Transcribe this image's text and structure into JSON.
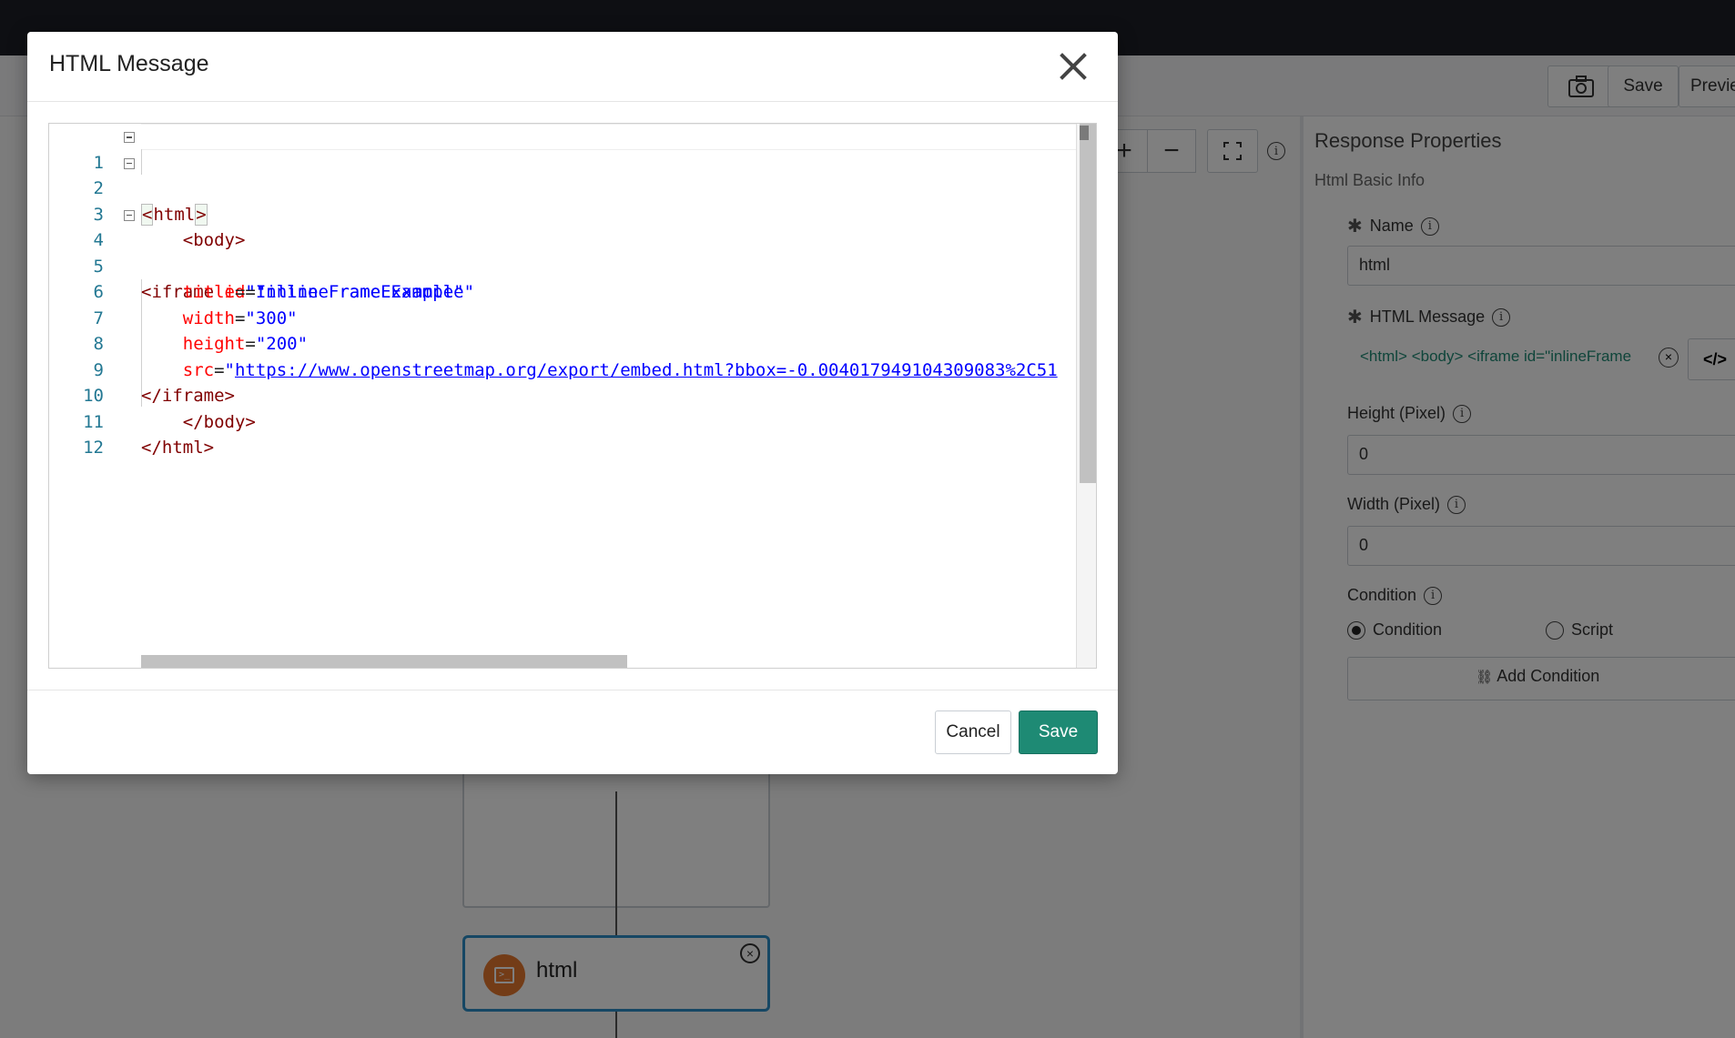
{
  "toolbar": {
    "save_label": "Save",
    "preview_label": "Previe"
  },
  "flow": {
    "node_label": "html"
  },
  "panel": {
    "title": "Response Properties",
    "section": "Html Basic Info",
    "name_label": "Name",
    "name_value": "html",
    "html_label": "HTML Message",
    "html_value": "<html> <body> <iframe id=\"inlineFrame",
    "height_label": "Height (Pixel)",
    "height_value": "0",
    "width_label": "Width (Pixel)",
    "width_value": "0",
    "condition_label": "Condition",
    "radio_condition": "Condition",
    "radio_script": "Script",
    "add_condition": "Add Condition"
  },
  "modal": {
    "title": "HTML Message",
    "cancel_label": "Cancel",
    "save_label": "Save",
    "line_numbers": [
      "1",
      "2",
      "3",
      "4",
      "5",
      "6",
      "7",
      "8",
      "9",
      "10",
      "11",
      "12"
    ]
  },
  "code": {
    "l1_open": "<",
    "l1_tag": "html",
    "l1_close": ">",
    "l2": "    <body>",
    "l4_tag": "<iframe ",
    "l4_attr": "id",
    "l4_eq": "=",
    "l4_val": "\"inlineFrameExample\"",
    "l5_attr": "    title",
    "l5_eq": "=",
    "l5_val": "\"Inline Frame Example\"",
    "l6_attr": "    width",
    "l6_eq": "=",
    "l6_val": "\"300\"",
    "l7_attr": "    height",
    "l7_eq": "=",
    "l7_val": "\"200\"",
    "l8_attr": "    src",
    "l8_eq": "=",
    "l8_quote": "\"",
    "l8_url": "https://www.openstreetmap.org/export/embed.html?bbox=-0.004017949104309083%2C51",
    "l9": "</iframe>",
    "l10": "    </body>",
    "l11": "</html>"
  },
  "colors": {
    "accent": "#1e8a74",
    "node_border": "#2c8fc9",
    "node_icon": "#e7782e"
  }
}
